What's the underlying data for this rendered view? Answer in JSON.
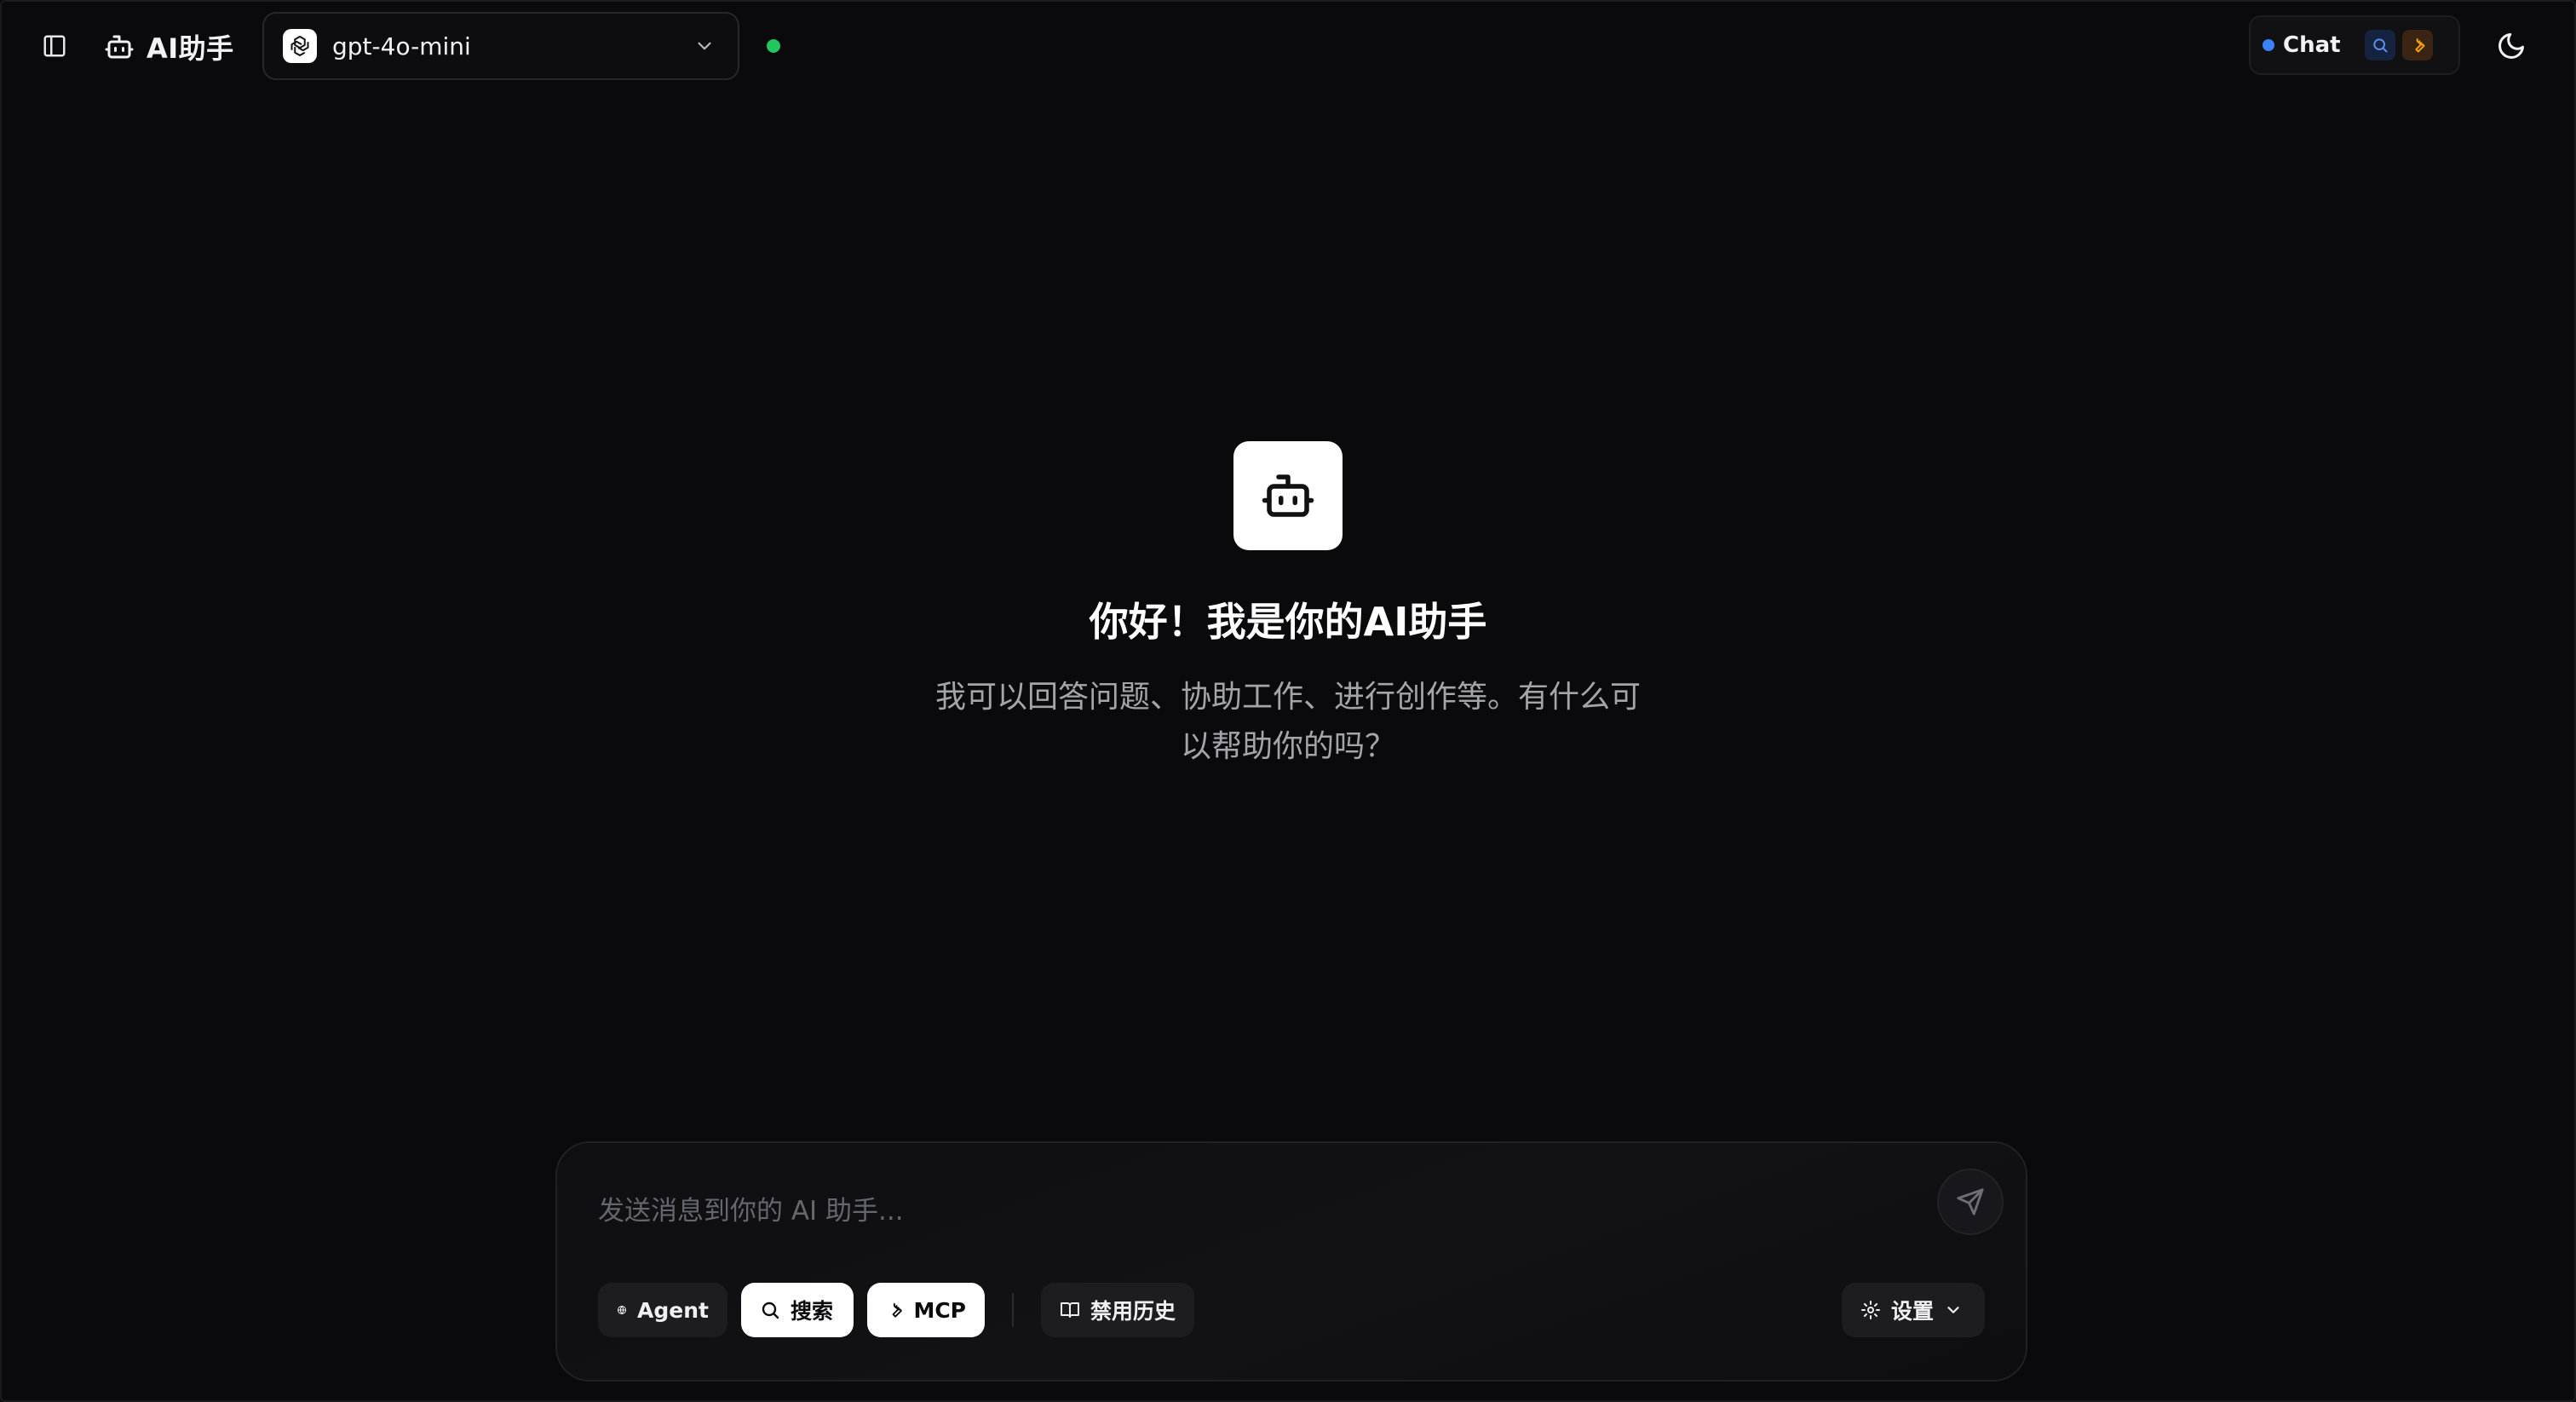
{
  "header": {
    "brand_name": "AI助手",
    "model": {
      "selected": "gpt-4o-mini"
    },
    "connection_status_color": "#22c55e",
    "mode_switch": {
      "active_label": "Chat",
      "icons": [
        "search-icon",
        "wrench-icon"
      ]
    }
  },
  "welcome": {
    "icon": "bot-icon",
    "title": "你好！我是你的AI助手",
    "subtitle": "我可以回答问题、协助工作、进行创作等。有什么可以帮助你的吗？"
  },
  "composer": {
    "placeholder": "发送消息到你的 AI 助手...",
    "value": "",
    "chips": {
      "agent": "Agent",
      "search": "搜索",
      "mcp": "MCP",
      "history": "禁用历史",
      "settings": "设置"
    }
  },
  "colors": {
    "background": "#0a0a0c",
    "accent_blue": "#3b82f6",
    "status_green": "#22c55e"
  }
}
